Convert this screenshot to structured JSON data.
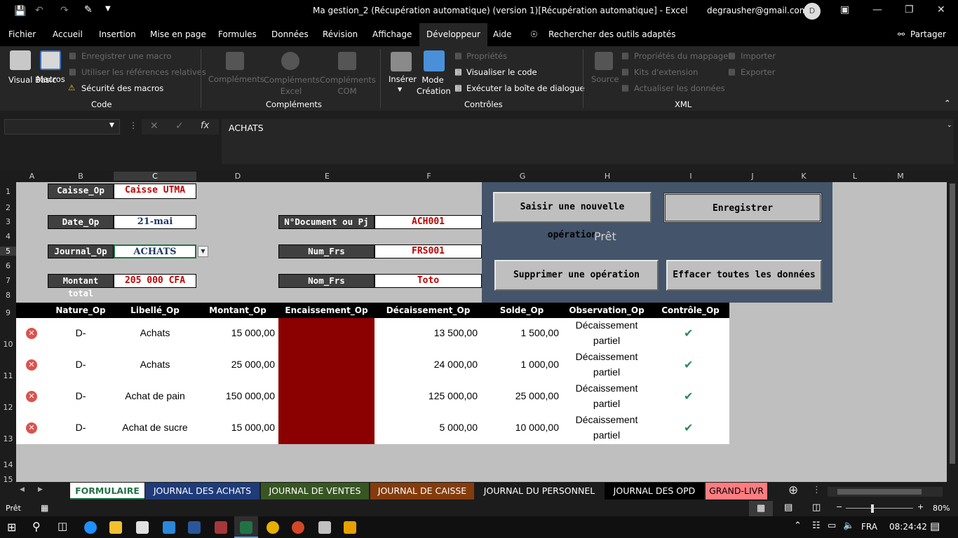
{
  "window": {
    "title": "Ma gestion_2 (Récupération automatique) (version 1)[Récupération automatique]  -  Excel",
    "email": "degrausher@gmail.com",
    "avatar_letter": "D"
  },
  "menu": {
    "tabs": [
      "Fichier",
      "Accueil",
      "Insertion",
      "Mise en page",
      "Formules",
      "Données",
      "Révision",
      "Affichage",
      "Développeur",
      "Aide"
    ],
    "active": "Développeur",
    "search": "Rechercher des outils adaptés",
    "share": "Partager"
  },
  "ribbon": {
    "code": {
      "visual_basic": "Visual Basic",
      "macros": "Macros",
      "record_macro": "Enregistrer une macro",
      "relative_refs": "Utiliser les références relatives",
      "macro_security": "Sécurité des macros",
      "group": "Code"
    },
    "addins": {
      "complements": "Compléments",
      "excel": "Compléments Excel",
      "com": "Compléments COM",
      "group": "Compléments"
    },
    "controls": {
      "insert": "Insérer",
      "design_mode": "Mode Création",
      "properties": "Propriétés",
      "view_code": "Visualiser le code",
      "run_dialog": "Exécuter la boîte de dialogue",
      "group": "Contrôles"
    },
    "xml": {
      "source": "Source",
      "map_props": "Propriétés du mappage",
      "ext_packs": "Kits d'extension",
      "refresh": "Actualiser les données",
      "import": "Importer",
      "export": "Exporter",
      "group": "XML"
    }
  },
  "formula_bar": {
    "name_box": "",
    "value": "ACHATS"
  },
  "columns": [
    "A",
    "B",
    "C",
    "D",
    "E",
    "F",
    "G",
    "H",
    "I",
    "J",
    "K",
    "L",
    "M"
  ],
  "rows": [
    "1",
    "2",
    "3",
    "4",
    "5",
    "6",
    "7",
    "8",
    "9",
    "10",
    "11",
    "12",
    "13",
    "14",
    "15"
  ],
  "form": {
    "caisse_label": "Caisse_Op",
    "caisse_value": "Caisse UTMA",
    "date_label": "Date_Op",
    "date_value": "21-mai",
    "journal_label": "Journal_Op",
    "journal_value": "ACHATS",
    "montant_label": "Montant total",
    "montant_value": "205 000 CFA",
    "doc_label": "N°Document ou Pj",
    "doc_value": "ACH001",
    "numfrs_label": "Num_Frs",
    "numfrs_value": "FRS001",
    "nomfrs_label": "Nom_Frs",
    "nomfrs_value": "Toto"
  },
  "panel": {
    "new_op": "Saisir une nouvelle opération",
    "save": "Enregistrer",
    "status": "Prêt",
    "delete_op": "Supprimer une opération",
    "clear_all": "Effacer toutes les données"
  },
  "table": {
    "headers": [
      "Nature_Op",
      "Libellé_Op",
      "Montant_Op",
      "Encaissement_Op",
      "Décaissement_Op",
      "Solde_Op",
      "Observation_Op",
      "Contrôle_Op"
    ],
    "rows": [
      {
        "nature": "D-",
        "libelle": "Achats",
        "montant": "15 000,00",
        "decaissement": "13 500,00",
        "solde": "1 500,00",
        "obs1": "Décaissement",
        "obs2": "partiel"
      },
      {
        "nature": "D-",
        "libelle": "Achats",
        "montant": "25 000,00",
        "decaissement": "24 000,00",
        "solde": "1 000,00",
        "obs1": "Décaissement",
        "obs2": "partiel"
      },
      {
        "nature": "D-",
        "libelle": "Achat de pain",
        "montant": "150 000,00",
        "decaissement": "125 000,00",
        "solde": "25 000,00",
        "obs1": "Décaissement",
        "obs2": "partiel"
      },
      {
        "nature": "D-",
        "libelle": "Achat de sucre",
        "montant": "15 000,00",
        "decaissement": "5 000,00",
        "solde": "10 000,00",
        "obs1": "Décaissement",
        "obs2": "partiel"
      }
    ]
  },
  "sheet_tabs": [
    {
      "label": "FORMULAIRE",
      "color": "#ffffff",
      "text": "#217346"
    },
    {
      "label": "JOURNAL DES ACHATS",
      "color": "#1f3b7a",
      "text": "#ffffff"
    },
    {
      "label": "JOURNAL DE VENTES",
      "color": "#375623",
      "text": "#ffffff"
    },
    {
      "label": "JOURNAL DE CAISSE",
      "color": "#843c0c",
      "text": "#ffffff"
    },
    {
      "label": "JOURNAL DU PERSONNEL",
      "color": "#1c1c1c",
      "text": "#ffffff"
    },
    {
      "label": "JOURNAL DES OPD",
      "color": "#000000",
      "text": "#ffffff"
    },
    {
      "label": "GRAND-LIVR",
      "color": "#ff7c80",
      "text": "#000000"
    }
  ],
  "status_bar": {
    "ready": "Prêt",
    "zoom": "80%"
  },
  "taskbar": {
    "lang": "FRA",
    "time": "08:24:42"
  }
}
